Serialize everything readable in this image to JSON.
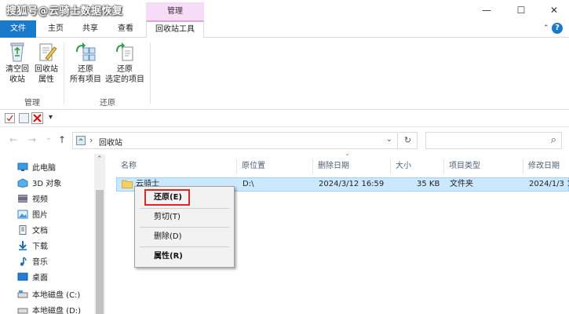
{
  "watermark": "搜狐号@云骑士数据恢复",
  "window": {
    "context_group_label": "管理",
    "minimize": "—",
    "maximize": "☐",
    "close": "✕"
  },
  "tabs": [
    {
      "label": "文件"
    },
    {
      "label": "主页"
    },
    {
      "label": "共享"
    },
    {
      "label": "查看"
    },
    {
      "label": "回收站工具"
    }
  ],
  "tabs_right": {
    "chevron": "⌃",
    "help": "?"
  },
  "ribbon": {
    "groups": [
      {
        "label": "管理",
        "buttons": [
          {
            "label": "清空回\n收站",
            "icon": "empty-recycle-bin-icon"
          },
          {
            "label": "回收站\n属性",
            "icon": "properties-icon"
          }
        ]
      },
      {
        "label": "还原",
        "buttons": [
          {
            "label": "还原\n所有项目",
            "icon": "restore-all-icon"
          },
          {
            "label": "还原\n选定的项目",
            "icon": "restore-selected-icon"
          }
        ]
      }
    ]
  },
  "qat": {
    "dropdown": "▾"
  },
  "address": {
    "back": "←",
    "forward": "→",
    "recent": "⌄",
    "up": "↑",
    "separator": "›",
    "path": "回收站",
    "dropdown": "⌄",
    "refresh": "↻",
    "search_icon": "⌕"
  },
  "nav": [
    {
      "label": "此电脑",
      "icon": "this-pc-icon"
    },
    {
      "label": "3D 对象",
      "icon": "3d-objects-icon"
    },
    {
      "label": "视频",
      "icon": "videos-icon"
    },
    {
      "label": "图片",
      "icon": "pictures-icon"
    },
    {
      "label": "文档",
      "icon": "documents-icon"
    },
    {
      "label": "下载",
      "icon": "downloads-icon"
    },
    {
      "label": "音乐",
      "icon": "music-icon"
    },
    {
      "label": "桌面",
      "icon": "desktop-icon"
    },
    {
      "label": "本地磁盘 (C:)",
      "icon": "drive-icon"
    },
    {
      "label": "本地磁盘 (D:)",
      "icon": "drive-icon"
    }
  ],
  "nav_scroll_up": "⌃",
  "columns": [
    {
      "label": "名称"
    },
    {
      "label": "原位置"
    },
    {
      "label": "删除日期"
    },
    {
      "label": "大小"
    },
    {
      "label": "项目类型"
    },
    {
      "label": "修改日期"
    }
  ],
  "sort_indicator": "ˇ",
  "files": [
    {
      "name": "云骑士",
      "location": "D:\\",
      "deleted": "2024/3/12 16:59",
      "size": "35 KB",
      "type": "文件夹",
      "modified": "2024/1/3 1"
    }
  ],
  "context_menu": {
    "items": [
      {
        "label": "还原(E)",
        "bold": true
      },
      {
        "label": "剪切(T)"
      },
      {
        "label": "删除(D)"
      },
      {
        "label": "属性(R)",
        "bold": true
      }
    ],
    "highlight_color": "#e12424"
  },
  "colors": {
    "file_tab": "#1979ca",
    "context_tab": "#f7dcf8",
    "selection": "#cce8ff"
  }
}
